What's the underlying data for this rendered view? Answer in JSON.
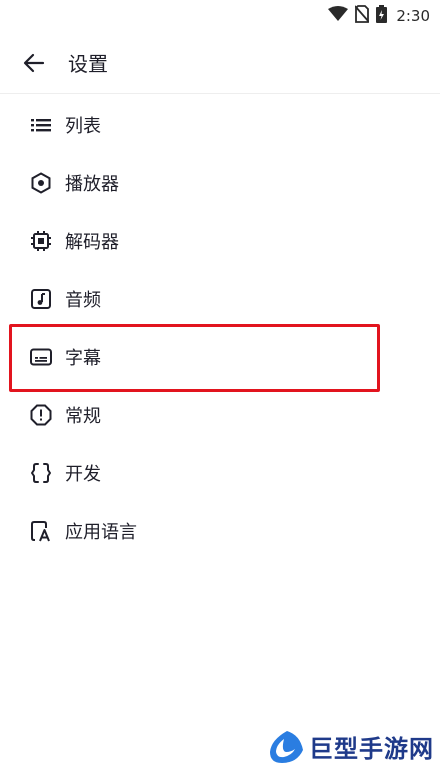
{
  "status_bar": {
    "time": "2:30",
    "icons": [
      "wifi-icon",
      "no-sim-icon",
      "battery-icon"
    ]
  },
  "app_bar": {
    "title": "设置",
    "back_icon": "arrow-left-icon"
  },
  "menu": {
    "items": [
      {
        "label": "列表",
        "icon": "list-icon"
      },
      {
        "label": "播放器",
        "icon": "player-hexagon-icon"
      },
      {
        "label": "解码器",
        "icon": "chip-icon"
      },
      {
        "label": "音频",
        "icon": "music-note-icon"
      },
      {
        "label": "字幕",
        "icon": "subtitles-icon",
        "highlighted": true
      },
      {
        "label": "常规",
        "icon": "info-octagon-icon"
      },
      {
        "label": "开发",
        "icon": "code-braces-icon"
      },
      {
        "label": "应用语言",
        "icon": "language-icon"
      }
    ]
  },
  "colors": {
    "highlight": "#e2141e",
    "text": "#1f1f2a",
    "watermark": "#1f3a8a"
  },
  "watermark": {
    "text": "巨型手游网"
  }
}
